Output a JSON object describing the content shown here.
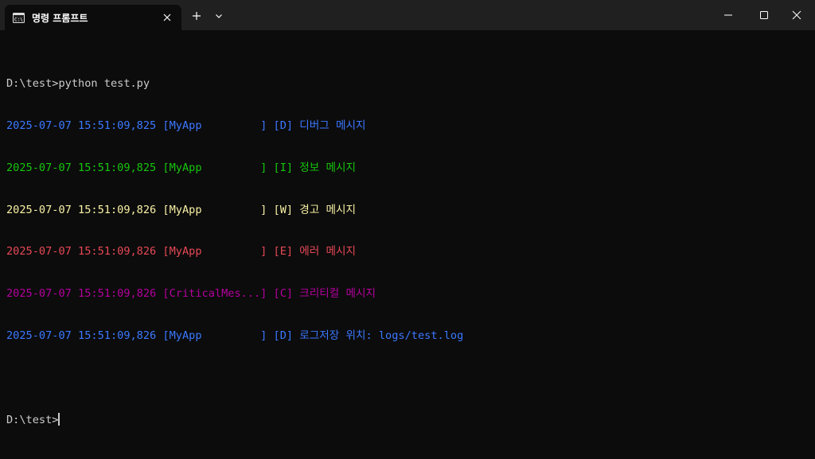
{
  "window": {
    "tab_title": "명령 프롬프트",
    "tab_icon": "cmd-icon",
    "new_tab_icon": "plus-icon",
    "dropdown_icon": "chevron-down-icon",
    "controls": [
      "minimize-icon",
      "maximize-icon",
      "close-icon"
    ]
  },
  "colors": {
    "background": "#0c0c0c",
    "titlebar": "#202020",
    "text": "#cccccc",
    "debug": "#3b78ff",
    "info": "#16c60c",
    "warning": "#f9f1a5",
    "error": "#e74856",
    "critical": "#b4009e"
  },
  "terminal": {
    "command_line": "D:\\test>python test.py",
    "log_lines": [
      {
        "level": "debug",
        "text": "2025-07-07 15:51:09,825 [MyApp         ] [D] 디버그 메시지"
      },
      {
        "level": "info",
        "text": "2025-07-07 15:51:09,825 [MyApp         ] [I] 정보 메시지"
      },
      {
        "level": "warning",
        "text": "2025-07-07 15:51:09,826 [MyApp         ] [W] 경고 메시지"
      },
      {
        "level": "error",
        "text": "2025-07-07 15:51:09,826 [MyApp         ] [E] 에러 메시지"
      },
      {
        "level": "critical",
        "text": "2025-07-07 15:51:09,826 [CriticalMes...] [C] 크리티컬 메시지"
      },
      {
        "level": "debug",
        "text": "2025-07-07 15:51:09,826 [MyApp         ] [D] 로그저장 위치: logs/test.log"
      }
    ],
    "prompt": "D:\\test>"
  }
}
